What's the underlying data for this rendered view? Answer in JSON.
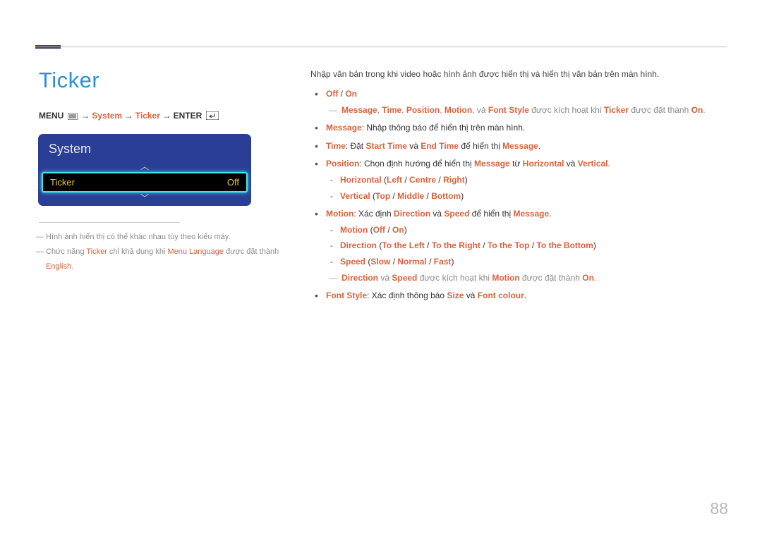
{
  "page_number": "88",
  "title": "Ticker",
  "nav": {
    "menu_label": "MENU",
    "arrow": "→",
    "item1": "System",
    "item2": "Ticker",
    "enter_label": "ENTER"
  },
  "osd": {
    "title": "System",
    "row_label": "Ticker",
    "row_value": "Off",
    "up_glyph": "︿",
    "down_glyph": "﹀"
  },
  "footnotes": {
    "n1_pre": "Hình ảnh hiển thị có thể khác nhau tùy theo kiểu máy.",
    "n2_a": "Chức năng ",
    "n2_b": "Ticker",
    "n2_c": " chỉ khả dụng khi ",
    "n2_d": "Menu Language",
    "n2_e": " được đặt thành ",
    "n2_f": "English",
    "n2_g": "."
  },
  "intro": "Nhập văn bản trong khi video hoặc hình ảnh được hiển thị và hiển thị văn bản trên màn hình.",
  "items": {
    "off": "Off",
    "slash": " / ",
    "on": "On",
    "d1_a": "Message",
    "d1_b": "Time",
    "d1_c": "Position",
    "d1_d": "Motion",
    "d1_e": "Font Style",
    "d1_mid": ", và ",
    "d1_tail_a": " được kích hoạt khi ",
    "d1_tail_b": "Ticker",
    "d1_tail_c": " được đặt thành ",
    "d1_tail_d": "On",
    "d1_tail_e": ".",
    "msg_k": "Message",
    "msg_t": ": Nhập thông báo để hiển thị trên màn hình.",
    "time_k": "Time",
    "time_a": ": Đặt ",
    "time_b": "Start Time",
    "time_c": " và ",
    "time_d": "End Time",
    "time_e": " để hiển thị ",
    "time_f": "Message",
    "time_g": ".",
    "pos_k": "Position",
    "pos_a": ": Chọn định hướng để hiển thị ",
    "pos_b": "Message",
    "pos_c": " từ ",
    "pos_d": "Horizontal",
    "pos_e": " và ",
    "pos_f": "Vertical",
    "pos_g": ".",
    "pos_h_k": "Horizontal",
    "pos_h_l": "Left",
    "pos_h_c": "Centre",
    "pos_h_r": "Right",
    "pos_v_k": "Vertical",
    "pos_v_t": "Top",
    "pos_v_m": "Middle",
    "pos_v_b": "Bottom",
    "mot_k": "Motion",
    "mot_a": ": Xác định ",
    "mot_b": "Direction",
    "mot_c": " và ",
    "mot_d": "Speed",
    "mot_e": " để hiển thị ",
    "mot_f": "Message",
    "mot_g": ".",
    "mot_sub_k": "Motion",
    "mot_sub_off": "Off",
    "mot_sub_on": "On",
    "dir_k": "Direction",
    "dir_l": "To the Left",
    "dir_r": "To the Right",
    "dir_t": "To the Top",
    "dir_b": "To the Bottom",
    "spd_k": "Speed",
    "spd_s": "Slow",
    "spd_n": "Normal",
    "spd_f": "Fast",
    "d2_a": "Direction",
    "d2_b": " và ",
    "d2_c": "Speed",
    "d2_d": " được kích hoạt khi ",
    "d2_e": "Motion",
    "d2_f": " được đặt thành ",
    "d2_g": "On",
    "d2_h": ".",
    "fs_k": "Font Style",
    "fs_a": ": Xác định thông báo ",
    "fs_b": "Size",
    "fs_c": " và ",
    "fs_d": "Font colour",
    "fs_e": ".",
    "open": " (",
    "close": ")",
    "comma": ", "
  }
}
